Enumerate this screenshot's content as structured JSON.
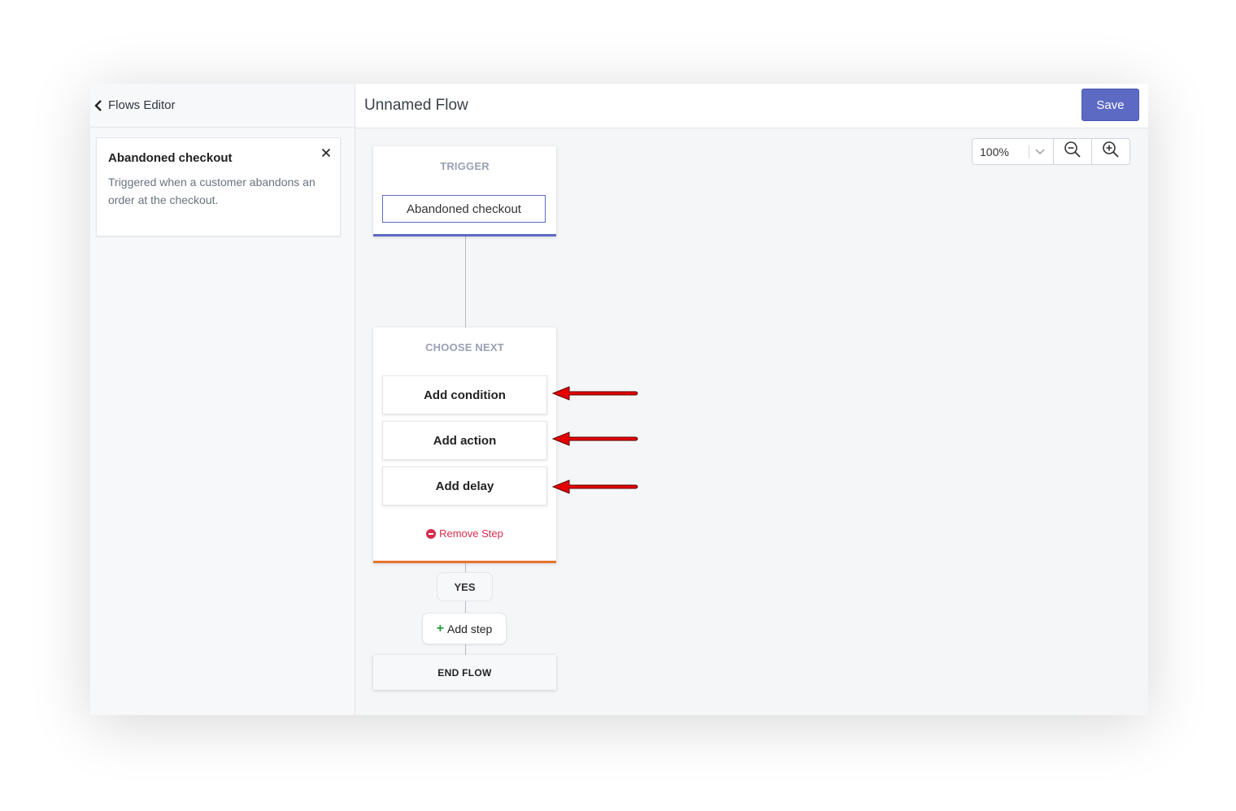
{
  "sidebar": {
    "back_label": "Flows Editor",
    "info": {
      "title": "Abandoned checkout",
      "description": "Triggered when a customer abandons an order at the checkout."
    }
  },
  "header": {
    "title": "Unnamed Flow",
    "save_label": "Save"
  },
  "zoom": {
    "level": "100%"
  },
  "trigger": {
    "label": "TRIGGER",
    "value": "Abandoned checkout"
  },
  "choose_next": {
    "label": "CHOOSE NEXT",
    "options": [
      "Add condition",
      "Add action",
      "Add delay"
    ],
    "remove_label": "Remove Step"
  },
  "branch": {
    "yes_label": "YES",
    "add_step_label": "Add step",
    "end_label": "END FLOW"
  },
  "colors": {
    "accent": "#5c6ac4",
    "choose_border": "#e8742e",
    "remove": "#d82c4f",
    "add_plus": "#2a9d3a",
    "annotation_arrow": "#e60000"
  }
}
